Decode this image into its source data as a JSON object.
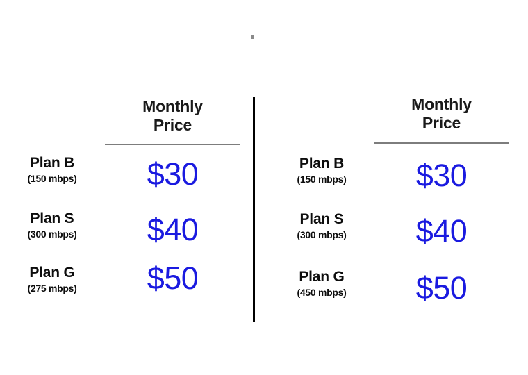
{
  "page": {
    "background_color": "#ffffff",
    "price_color": "#1a1ae0",
    "text_color": "#0d0d0d",
    "rule_color": "#7d7d7d",
    "divider_color": "#000000"
  },
  "tables": [
    {
      "id": "left-table",
      "column_header": {
        "line1": "Monthly",
        "line2": "Price"
      },
      "rows": [
        {
          "plan": "Plan B",
          "speed": "(150 mbps)",
          "price": "$30"
        },
        {
          "plan": "Plan S",
          "speed": "(300 mbps)",
          "price": "$40"
        },
        {
          "plan": "Plan G",
          "speed": "(275 mbps)",
          "price": "$50"
        }
      ]
    },
    {
      "id": "right-table",
      "column_header": {
        "line1": "Monthly",
        "line2": "Price"
      },
      "rows": [
        {
          "plan": "Plan B",
          "speed": "(150 mbps)",
          "price": "$30"
        },
        {
          "plan": "Plan S",
          "speed": "(300 mbps)",
          "price": "$40"
        },
        {
          "plan": "Plan G",
          "speed": "(450 mbps)",
          "price": "$50"
        }
      ]
    }
  ]
}
